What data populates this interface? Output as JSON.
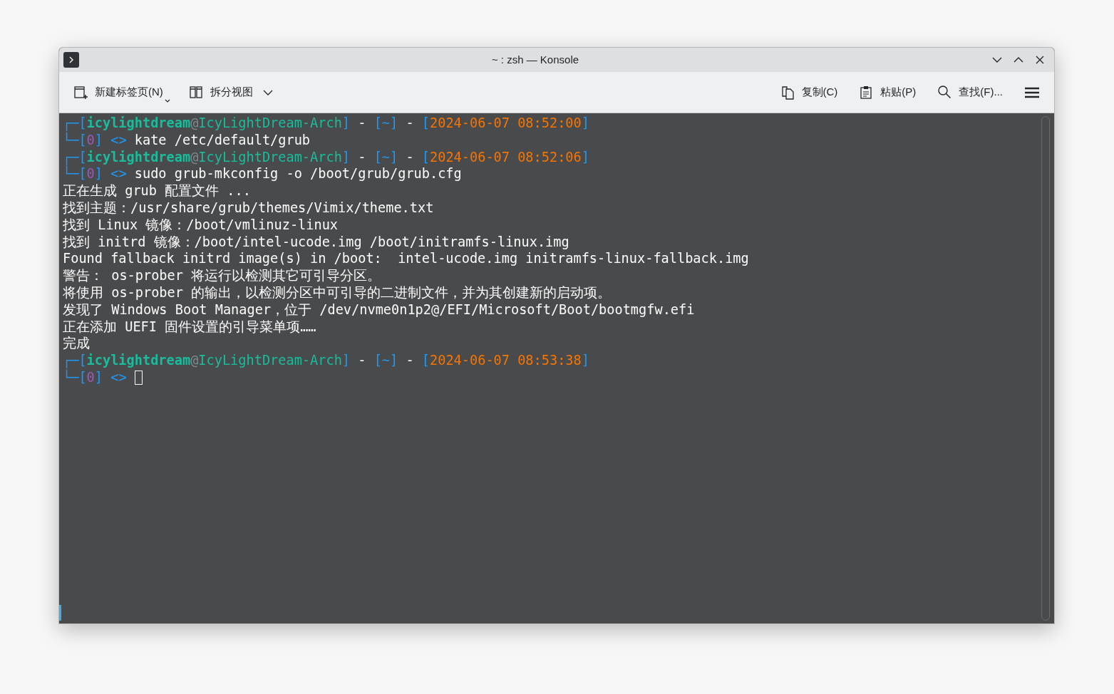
{
  "window": {
    "title": "~ : zsh — Konsole"
  },
  "toolbar": {
    "left": [
      {
        "label": "新建标签页(N)",
        "kind": "new-tab"
      },
      {
        "label": "拆分视图",
        "kind": "split"
      }
    ],
    "right": [
      {
        "label": "复制(C)",
        "kind": "copy"
      },
      {
        "label": "粘贴(P)",
        "kind": "paste"
      },
      {
        "label": "查找(F)...",
        "kind": "find"
      }
    ]
  },
  "terminal": {
    "lines": [
      {
        "segments": [
          {
            "text": "┌─[",
            "kind": "frame"
          },
          {
            "text": "icylightdream",
            "kind": "user"
          },
          {
            "text": "@",
            "kind": "at"
          },
          {
            "text": "IcyLightDream-Arch",
            "kind": "host"
          },
          {
            "text": "]",
            "kind": "frame"
          },
          {
            "text": " - ",
            "kind": "plain"
          },
          {
            "text": "[~]",
            "kind": "frame"
          },
          {
            "text": " - ",
            "kind": "plain"
          },
          {
            "text": "[",
            "kind": "frame"
          },
          {
            "text": "2024-06-07 08:52:00",
            "kind": "time"
          },
          {
            "text": "]",
            "kind": "frame"
          }
        ]
      },
      {
        "segments": [
          {
            "text": "└─[",
            "kind": "frame"
          },
          {
            "text": "0",
            "kind": "exit"
          },
          {
            "text": "]",
            "kind": "frame"
          },
          {
            "text": " <>",
            "kind": "frame"
          },
          {
            "text": " kate /etc/default/grub",
            "kind": "plain"
          }
        ]
      },
      {
        "segments": [
          {
            "text": "┌─[",
            "kind": "frame"
          },
          {
            "text": "icylightdream",
            "kind": "user"
          },
          {
            "text": "@",
            "kind": "at"
          },
          {
            "text": "IcyLightDream-Arch",
            "kind": "host"
          },
          {
            "text": "]",
            "kind": "frame"
          },
          {
            "text": " - ",
            "kind": "plain"
          },
          {
            "text": "[~]",
            "kind": "frame"
          },
          {
            "text": " - ",
            "kind": "plain"
          },
          {
            "text": "[",
            "kind": "frame"
          },
          {
            "text": "2024-06-07 08:52:06",
            "kind": "time"
          },
          {
            "text": "]",
            "kind": "frame"
          }
        ]
      },
      {
        "segments": [
          {
            "text": "└─[",
            "kind": "frame"
          },
          {
            "text": "0",
            "kind": "exit"
          },
          {
            "text": "]",
            "kind": "frame"
          },
          {
            "text": " <>",
            "kind": "frame"
          },
          {
            "text": " sudo grub-mkconfig -o /boot/grub/grub.cfg",
            "kind": "plain"
          }
        ]
      },
      {
        "segments": [
          {
            "text": "正在生成 grub 配置文件 ...",
            "kind": "plain"
          }
        ]
      },
      {
        "segments": [
          {
            "text": "找到主题：/usr/share/grub/themes/Vimix/theme.txt",
            "kind": "plain"
          }
        ]
      },
      {
        "segments": [
          {
            "text": "找到 Linux 镜像：/boot/vmlinuz-linux",
            "kind": "plain"
          }
        ]
      },
      {
        "segments": [
          {
            "text": "找到 initrd 镜像：/boot/intel-ucode.img /boot/initramfs-linux.img",
            "kind": "plain"
          }
        ]
      },
      {
        "segments": [
          {
            "text": "Found fallback initrd image(s) in /boot:  intel-ucode.img initramfs-linux-fallback.img",
            "kind": "plain"
          }
        ]
      },
      {
        "segments": [
          {
            "text": "警告： os-prober 将运行以检测其它可引导分区。",
            "kind": "plain"
          }
        ]
      },
      {
        "segments": [
          {
            "text": "将使用 os-prober 的输出，以检测分区中可引导的二进制文件，并为其创建新的启动项。",
            "kind": "plain"
          }
        ]
      },
      {
        "segments": [
          {
            "text": "发现了 Windows Boot Manager，位于 /dev/nvme0n1p2@/EFI/Microsoft/Boot/bootmgfw.efi",
            "kind": "plain"
          }
        ]
      },
      {
        "segments": [
          {
            "text": "正在添加 UEFI 固件设置的引导菜单项……",
            "kind": "plain"
          }
        ]
      },
      {
        "segments": [
          {
            "text": "完成",
            "kind": "plain"
          }
        ]
      },
      {
        "segments": [
          {
            "text": "┌─[",
            "kind": "frame"
          },
          {
            "text": "icylightdream",
            "kind": "user"
          },
          {
            "text": "@",
            "kind": "at"
          },
          {
            "text": "IcyLightDream-Arch",
            "kind": "host"
          },
          {
            "text": "]",
            "kind": "frame"
          },
          {
            "text": " - ",
            "kind": "plain"
          },
          {
            "text": "[~]",
            "kind": "frame"
          },
          {
            "text": " - ",
            "kind": "plain"
          },
          {
            "text": "[",
            "kind": "frame"
          },
          {
            "text": "2024-06-07 08:53:38",
            "kind": "time"
          },
          {
            "text": "]",
            "kind": "frame"
          }
        ]
      },
      {
        "segments": [
          {
            "text": "└─[",
            "kind": "frame"
          },
          {
            "text": "0",
            "kind": "exit"
          },
          {
            "text": "]",
            "kind": "frame"
          },
          {
            "text": " <>",
            "kind": "frame"
          }
        ],
        "cursor": true
      }
    ]
  }
}
